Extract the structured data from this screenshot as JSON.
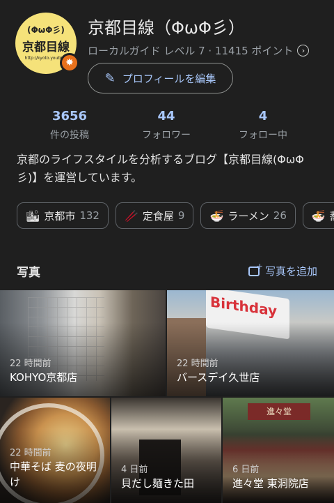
{
  "profile": {
    "avatar_line1": "(ΦωΦ彡)",
    "avatar_line2": "京都目線",
    "avatar_line3": "http://kyoto.youblog",
    "name": "京都目線（ΦωΦ彡）",
    "guide_text": "ローカルガイド レベル 7 · 11415 ポイント",
    "edit_label": "プロフィールを編集"
  },
  "stats": [
    {
      "value": "3656",
      "label": "件の投稿"
    },
    {
      "value": "44",
      "label": "フォロワー"
    },
    {
      "value": "4",
      "label": "フォロー中"
    }
  ],
  "bio": "京都のライフスタイルを分析するブログ【京都目線(ΦωΦ彡)】を運営しています。",
  "chips": [
    {
      "icon": "🏙",
      "label": "京都市",
      "count": "132"
    },
    {
      "icon": "🥢",
      "label": "定食屋",
      "count": "9"
    },
    {
      "icon": "🍜",
      "label": "ラーメン",
      "count": "26"
    },
    {
      "icon": "🍜",
      "label": "蕎",
      "count": ""
    }
  ],
  "photos": {
    "title": "写真",
    "add_label": "写真を追加",
    "items": [
      {
        "time": "22 時間前",
        "place": "KOHYO京都店"
      },
      {
        "time": "22 時間前",
        "place": "バースデイ久世店",
        "sign": "Birthday"
      },
      {
        "time": "22 時間前",
        "place": "中華そば 麦の夜明け"
      },
      {
        "time": "4 日前",
        "place": "貝だし麺きた田"
      },
      {
        "time": "6 日前",
        "place": "進々堂 東洞院店",
        "sign": "進々堂"
      }
    ]
  }
}
